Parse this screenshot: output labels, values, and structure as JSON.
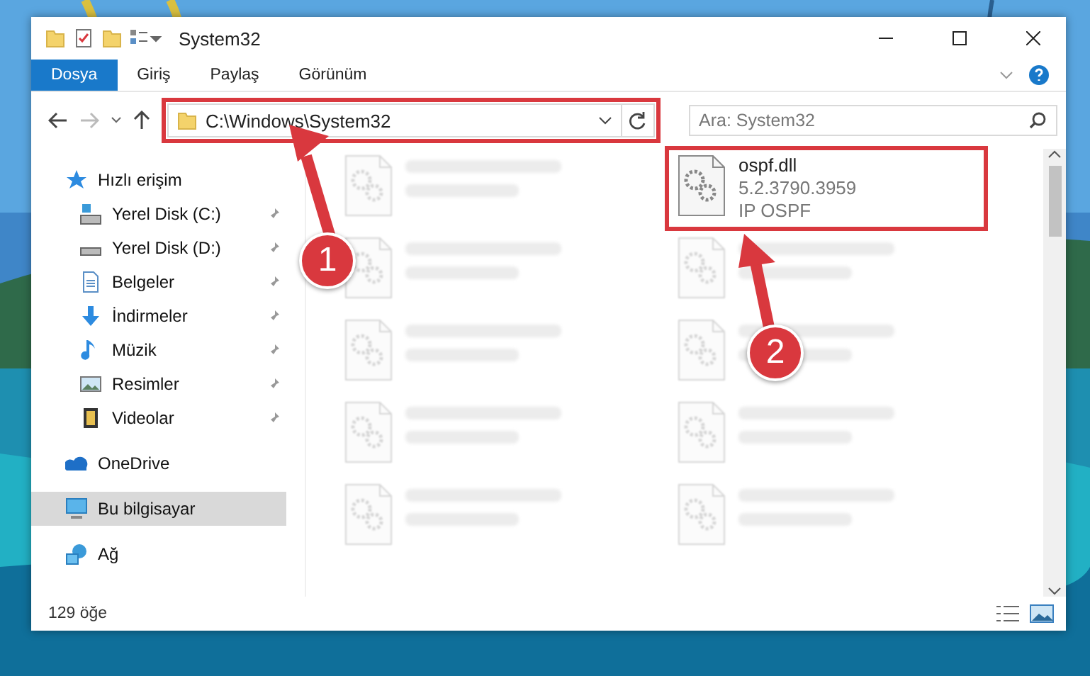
{
  "window": {
    "title": "System32"
  },
  "ribbon_tabs": [
    {
      "label": "Dosya",
      "selected": true
    },
    {
      "label": "Giriş",
      "selected": false
    },
    {
      "label": "Paylaş",
      "selected": false
    },
    {
      "label": "Görünüm",
      "selected": false
    }
  ],
  "address": {
    "path": "C:\\Windows\\System32",
    "highlighted": true
  },
  "search": {
    "placeholder": "Ara: System32"
  },
  "sidebar": {
    "items": [
      {
        "label": "Hızlı erişim",
        "selected": false,
        "children": [
          {
            "label": "Yerel Disk (C:)",
            "pinned": true,
            "selected": false
          },
          {
            "label": "Yerel Disk (D:)",
            "pinned": true,
            "selected": false
          },
          {
            "label": "Belgeler",
            "pinned": true,
            "selected": false
          },
          {
            "label": "İndirmeler",
            "pinned": true,
            "selected": false
          },
          {
            "label": "Müzik",
            "pinned": true,
            "selected": false
          },
          {
            "label": "Resimler",
            "pinned": true,
            "selected": false
          },
          {
            "label": "Videolar",
            "pinned": true,
            "selected": false
          }
        ]
      },
      {
        "label": "OneDrive",
        "selected": false
      },
      {
        "label": "Bu bilgisayar",
        "selected": true
      },
      {
        "label": "Ağ",
        "selected": false
      }
    ]
  },
  "files": [
    {
      "kind": "blurred"
    },
    {
      "kind": "file",
      "lines": [
        "ospf.dll",
        "5.2.3790.3959",
        "IP OSPF"
      ],
      "highlighted": true
    },
    {
      "kind": "blurred"
    },
    {
      "kind": "blurred"
    },
    {
      "kind": "blurred"
    },
    {
      "kind": "blurred"
    },
    {
      "kind": "blurred"
    },
    {
      "kind": "blurred"
    },
    {
      "kind": "blurred"
    },
    {
      "kind": "blurred"
    }
  ],
  "status_bar": {
    "count": "129 öğe"
  },
  "callouts": [
    {
      "number": "1"
    },
    {
      "number": "2"
    }
  ]
}
